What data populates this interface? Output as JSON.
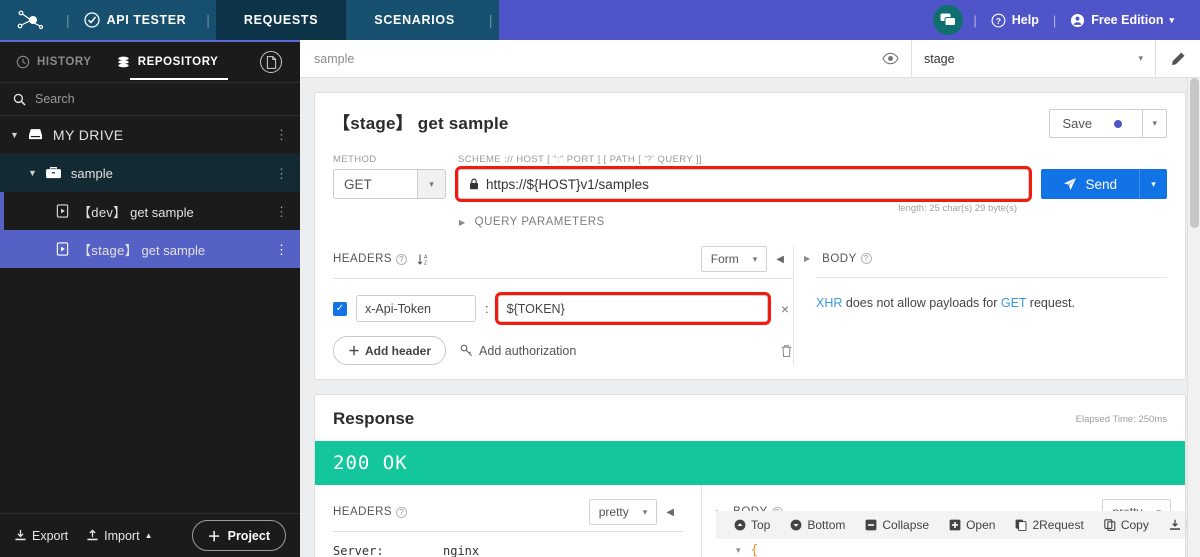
{
  "topbar": {
    "brand": "API TESTER",
    "tabs": [
      {
        "label": "REQUESTS",
        "active": true
      },
      {
        "label": "SCENARIOS",
        "active": false
      }
    ],
    "help_label": "Help",
    "edition_label": "Free Edition",
    "separator": "|",
    "accent_color": "#4f55c8",
    "brand_bg": "#17506e",
    "active_tab_bg": "#0d3349",
    "chat_badge_color": "#0f6e6e"
  },
  "sidebar": {
    "tabs": [
      {
        "label": "HISTORY",
        "icon": "history-icon",
        "active": false
      },
      {
        "label": "REPOSITORY",
        "icon": "database-icon",
        "active": true
      }
    ],
    "doc_icon": "document-icon",
    "search": {
      "placeholder": "Search",
      "icon": "search-icon"
    },
    "tree": [
      {
        "label": "MY DRIVE",
        "type": "drive",
        "icon": "drive-icon",
        "expanded": true,
        "menu": "⋮"
      },
      {
        "label": "sample",
        "type": "folder",
        "icon": "briefcase-icon",
        "expanded": true,
        "menu": "⋮"
      },
      {
        "env": "【dev】",
        "label": "get sample",
        "type": "file",
        "icon": "request-file-icon",
        "selected": false,
        "menu": "⋮"
      },
      {
        "env": "【stage】",
        "label": "get sample",
        "type": "file",
        "icon": "request-file-icon",
        "selected": true,
        "menu": "⋮"
      }
    ],
    "footer": {
      "export_label": "Export",
      "import_label": "Import",
      "import_caret": "▲",
      "project_label": "Project",
      "project_plus": "＋"
    }
  },
  "main_header": {
    "breadcrumb": "sample",
    "eye_icon": "eye-icon",
    "stage_value": "stage",
    "stage_caret": "▾",
    "edit_icon": "pencil-icon"
  },
  "request": {
    "title": "【stage】 get sample",
    "save_label": "Save",
    "save_caret": "▾",
    "method_label": "METHOD",
    "method_value": "GET",
    "method_caret": "▾",
    "url_label": "SCHEME :// HOST [ \":\" PORT ] [ PATH [ '?' QUERY ]]",
    "url_value": "https://${HOST}v1/samples",
    "url_lock_icon": "lock-icon",
    "url_highlighted": true,
    "send_label": "Send",
    "send_caret": "▾",
    "length_note": "length: 25 char(s) 29 byte(s)",
    "query_params_label": "QUERY PARAMETERS",
    "query_params_caret": "▶",
    "headers": {
      "title": "HEADERS",
      "help_icon": "help-icon",
      "sort_icon": "sort-az-icon",
      "mode_value": "Form",
      "mode_caret": "▾",
      "prev_caret": "◀",
      "next_caret": "▶",
      "rows": [
        {
          "enabled": true,
          "key": "x-Api-Token",
          "separator": ":",
          "value": "${TOKEN}",
          "value_highlighted": true,
          "remove": "×"
        }
      ],
      "add_header_label": "Add header",
      "add_header_plus": "＋",
      "add_auth_label": "Add authorization",
      "add_auth_icon": "key-icon",
      "delete_icon": "trash-icon"
    },
    "body": {
      "title": "BODY",
      "help_icon": "help-icon",
      "expand_caret": "▶",
      "note_prefix": "XHR",
      "note_middle": " does not allow payloads for ",
      "note_method": "GET",
      "note_suffix": " request.",
      "link_color": "#3a9bdc"
    }
  },
  "response": {
    "title": "Response",
    "elapsed": "Elapsed Time: 250ms",
    "status": "200 OK",
    "status_color": "#14c69c",
    "headers": {
      "title": "HEADERS",
      "help_icon": "help-icon",
      "mode_value": "pretty",
      "mode_caret": "▾",
      "prev_caret": "◀",
      "next_caret": "▶",
      "rows": [
        {
          "key": "Server:",
          "value": "nginx"
        }
      ]
    },
    "body": {
      "title": "BODY",
      "help_icon": "help-icon",
      "expand_caret": "▶",
      "mode_value": "pretty",
      "mode_caret": "▾",
      "toolbar": [
        {
          "label": "Top",
          "icon": "arrow-up-circle-icon"
        },
        {
          "label": "Bottom",
          "icon": "arrow-down-circle-icon"
        },
        {
          "label": "Collapse",
          "icon": "minus-square-icon"
        },
        {
          "label": "Open",
          "icon": "plus-square-icon"
        },
        {
          "label": "2Request",
          "icon": "copy-to-request-icon"
        },
        {
          "label": "Copy",
          "icon": "copy-icon"
        },
        {
          "label": "Download",
          "icon": "download-icon"
        }
      ],
      "json_caret": "▾",
      "json_open_brace": "{"
    }
  }
}
